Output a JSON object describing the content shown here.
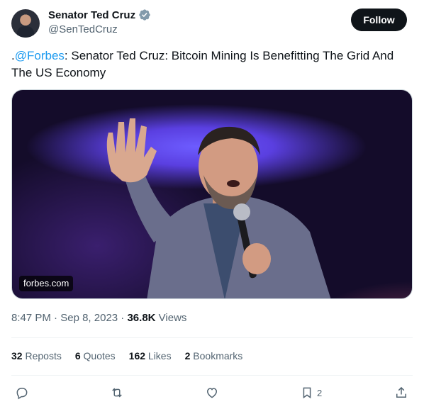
{
  "author": {
    "name": "Senator Ted Cruz",
    "handle": "@SenTedCruz",
    "verified_icon": "verified-badge-icon"
  },
  "follow_label": "Follow",
  "tweet": {
    "prefix": ".",
    "mention": "@Forbes",
    "text": ": Senator Ted Cruz: Bitcoin Mining Is Benefitting The Grid And The US Economy"
  },
  "media": {
    "domain": "forbes.com"
  },
  "meta": {
    "time": "8:47 PM",
    "date": "Sep 8, 2023",
    "views_count": "36.8K",
    "views_label": "Views",
    "sep": "·"
  },
  "stats": {
    "reposts_count": "32",
    "reposts_label": "Reposts",
    "quotes_count": "6",
    "quotes_label": "Quotes",
    "likes_count": "162",
    "likes_label": "Likes",
    "bookmarks_count": "2",
    "bookmarks_label": "Bookmarks"
  },
  "actions": {
    "reply_icon": "reply-icon",
    "repost_icon": "repost-icon",
    "like_icon": "heart-icon",
    "bookmark_icon": "bookmark-icon",
    "bookmark_count": "2",
    "share_icon": "share-icon"
  },
  "colors": {
    "link": "#1d9bf0",
    "text": "#0f1419",
    "secondary": "#536471",
    "follow_bg": "#0f1419"
  }
}
